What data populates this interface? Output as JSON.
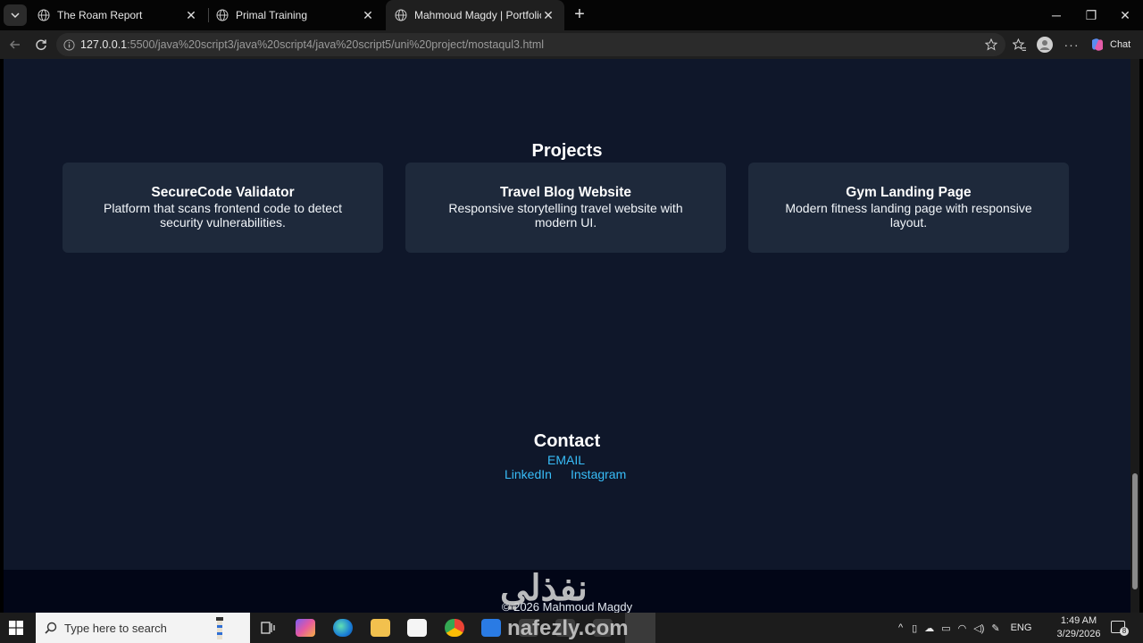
{
  "browser": {
    "tabs": [
      {
        "title": "The Roam Report"
      },
      {
        "title": "Primal Training"
      },
      {
        "title": "Mahmoud Magdy | Portfolio"
      }
    ],
    "url_host": "127.0.0.1",
    "url_rest": ":5500/java%20script3/java%20script4/java%20script5/uni%20project/mostaqul3.html",
    "chat_label": "Chat"
  },
  "page": {
    "projects_title": "Projects",
    "projects": [
      {
        "name": "SecureCode Validator",
        "description": "Platform that scans frontend code to detect security vulnerabilities."
      },
      {
        "name": "Travel Blog Website",
        "description": "Responsive storytelling travel website with modern UI."
      },
      {
        "name": "Gym Landing Page",
        "description": "Modern fitness landing page with responsive layout."
      }
    ],
    "contact_title": "Contact",
    "contact_links": {
      "email": "EMAIL",
      "linkedin": "LinkedIn",
      "instagram": "Instagram"
    },
    "footer_text": "© 2026 Mahmoud Magdy"
  },
  "taskbar": {
    "search_placeholder": "Type here to search",
    "language": "ENG",
    "time": "1:49 AM",
    "date": "3/29/2026",
    "notification_count": "8"
  },
  "watermark": {
    "arabic": "نفذلي",
    "latin": "nafezly.com"
  },
  "colors": {
    "page_bg": "#0f172a",
    "card_bg": "#1e293b",
    "link": "#38bdf8",
    "footer_bg": "#020617"
  }
}
